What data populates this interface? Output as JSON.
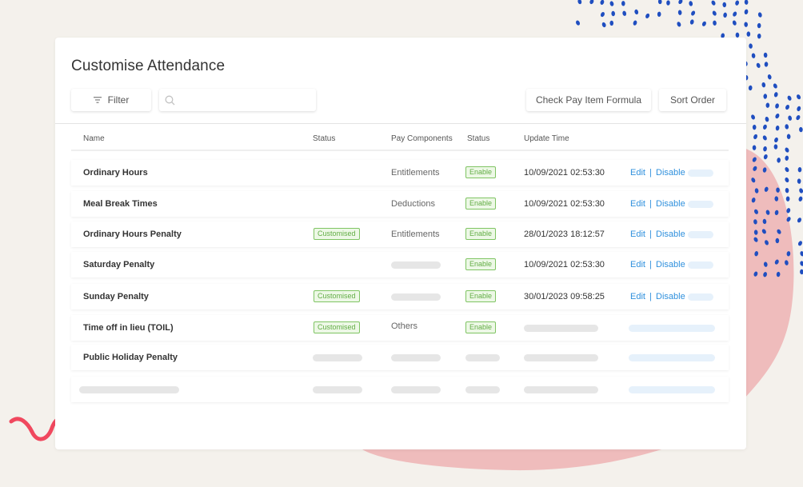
{
  "page": {
    "title": "Customise Attendance",
    "filter_label": "Filter",
    "search_placeholder": "",
    "check_formula_label": "Check Pay Item Formula",
    "sort_order_label": "Sort Order"
  },
  "table": {
    "headers": [
      "Name",
      "Status",
      "Pay Components",
      "Status",
      "Update Time"
    ],
    "rows": [
      {
        "name": "Ordinary Hours",
        "status": "",
        "pay_component": "Entitlements",
        "enable": "Enable",
        "update_time": "10/09/2021 02:53:30",
        "edit": "Edit",
        "sep": "|",
        "disable": "Disable"
      },
      {
        "name": "Meal Break Times",
        "status": "",
        "pay_component": "Deductions",
        "enable": "Enable",
        "update_time": "10/09/2021 02:53:30",
        "edit": "Edit",
        "sep": "|",
        "disable": "Disable"
      },
      {
        "name": "Ordinary Hours Penalty",
        "status": "Customised",
        "pay_component": "Entitlements",
        "enable": "Enable",
        "update_time": "28/01/2023 18:12:57",
        "edit": "Edit",
        "sep": "|",
        "disable": "Disable"
      },
      {
        "name": "Saturday Penalty",
        "status": "",
        "pay_component": "",
        "enable": "Enable",
        "update_time": "10/09/2021 02:53:30",
        "edit": "Edit",
        "sep": "|",
        "disable": "Disable"
      },
      {
        "name": "Sunday Penalty",
        "status": "Customised",
        "pay_component": "",
        "enable": "Enable",
        "update_time": "30/01/2023 09:58:25",
        "edit": "Edit",
        "sep": "|",
        "disable": "Disable"
      },
      {
        "name": "Time off in lieu  (TOIL)",
        "status": "Customised",
        "pay_component": "Others",
        "enable": "Enable",
        "update_time": "",
        "edit": "",
        "sep": "",
        "disable": ""
      },
      {
        "name": "Public Holiday Penalty",
        "status": "",
        "pay_component": "",
        "enable": "",
        "update_time": "",
        "edit": "",
        "sep": "",
        "disable": ""
      },
      {
        "name": "",
        "status": "",
        "pay_component": "",
        "enable": "",
        "update_time": "",
        "edit": "",
        "sep": "",
        "disable": ""
      }
    ]
  },
  "icons": {
    "filter": "filter-lines-icon",
    "search": "magnifier-icon"
  },
  "colors": {
    "background": "#f4f1ec",
    "accent_link": "#2f90dd",
    "tag_green": "#62ad45",
    "dots_blue": "#1f4ec0",
    "blob_pink": "#efbcbc",
    "squiggle_red": "#f0485e"
  }
}
